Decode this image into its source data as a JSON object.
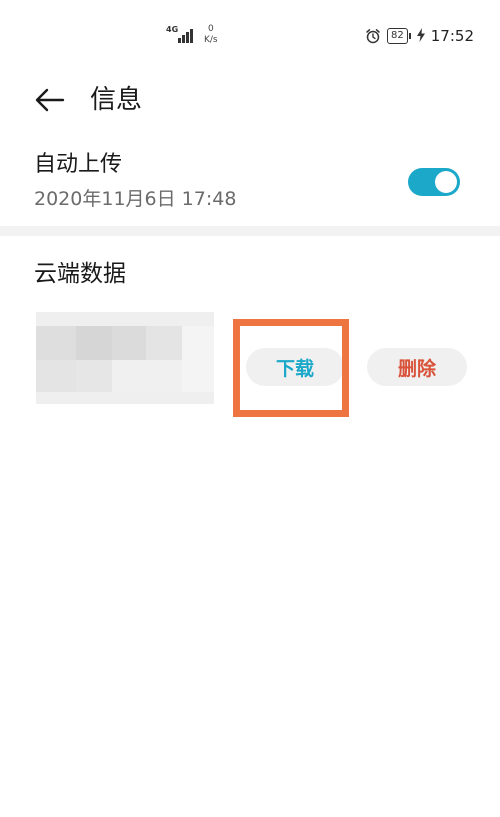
{
  "status_bar": {
    "network_type": "4G",
    "speed_value": "0",
    "speed_unit": "K/s",
    "battery": "82",
    "time": "17:52",
    "icons": [
      "signal-icon",
      "alarm-icon",
      "battery-icon",
      "charging-icon"
    ]
  },
  "header": {
    "title": "信息",
    "back_icon": "arrow-left-icon"
  },
  "auto_upload": {
    "label": "自动上传",
    "timestamp": "2020年11月6日 17:48",
    "enabled": true,
    "accent_color": "#1ba8c9"
  },
  "cloud_data": {
    "section_title": "云端数据",
    "download_label": "下载",
    "delete_label": "删除",
    "download_color": "#1ba8c9",
    "delete_color": "#d9523a",
    "highlight_color": "#ee7441"
  }
}
